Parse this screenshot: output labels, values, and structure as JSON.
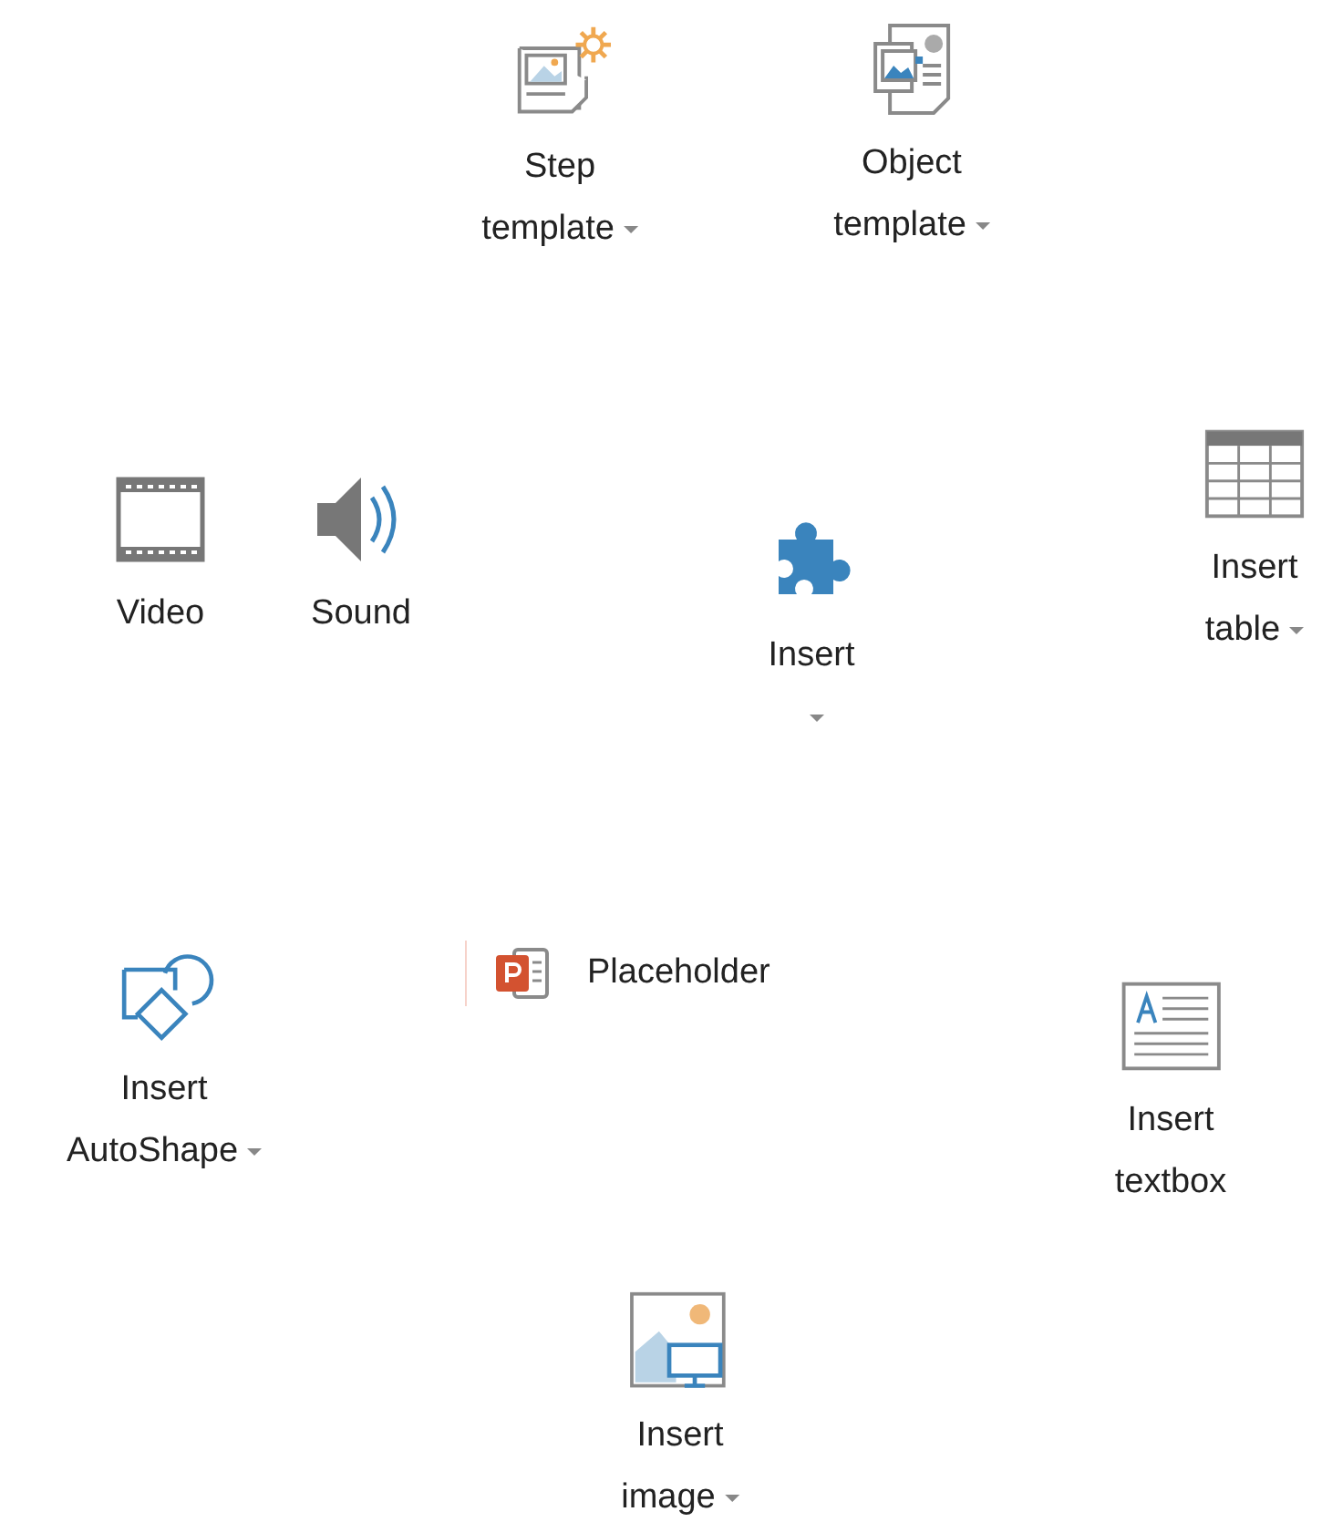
{
  "buttons": [
    {
      "kind": "large",
      "label_lines": [
        "Step",
        "template"
      ],
      "dropdown": true
    },
    {
      "kind": "large",
      "label_lines": [
        "Object",
        "template"
      ],
      "dropdown": true
    },
    {
      "kind": "large",
      "label_lines": [
        "Video"
      ],
      "dropdown": false
    },
    {
      "kind": "large",
      "label_lines": [
        "Sound"
      ],
      "dropdown": false
    },
    {
      "kind": "large",
      "label_lines": [
        "Insert"
      ],
      "dropdown": true
    },
    {
      "kind": "large",
      "label_lines": [
        "Insert",
        "table"
      ],
      "dropdown": true
    },
    {
      "kind": "large",
      "label_lines": [
        "Insert",
        "AutoShape"
      ],
      "dropdown": true
    },
    {
      "kind": "small",
      "label_lines": [
        "Placeholder"
      ],
      "dropdown": false
    },
    {
      "kind": "large",
      "label_lines": [
        "Insert",
        "textbox"
      ],
      "dropdown": false
    },
    {
      "kind": "large",
      "label_lines": [
        "Insert",
        "image"
      ],
      "dropdown": true
    }
  ]
}
